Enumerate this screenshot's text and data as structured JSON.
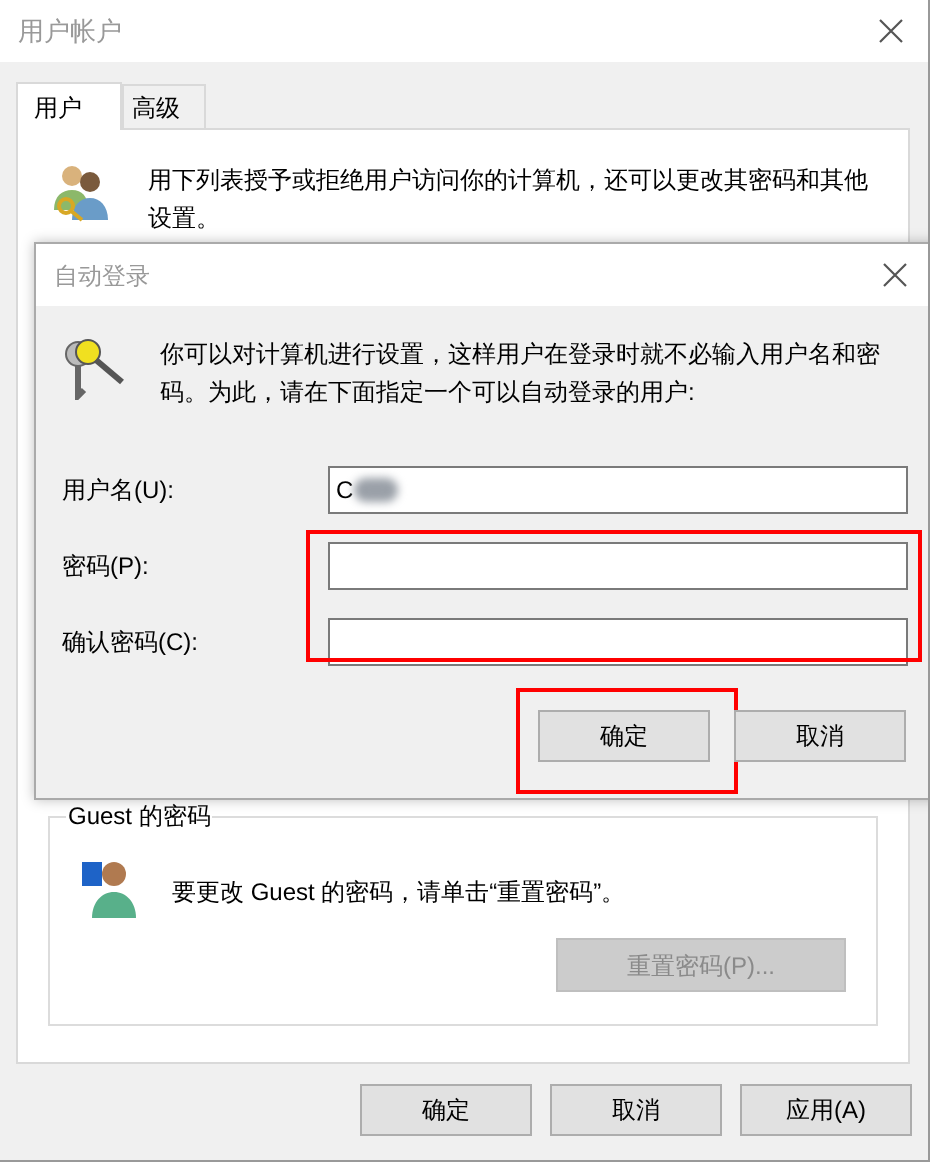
{
  "window": {
    "title": "用户帐户"
  },
  "tabs": [
    {
      "label": "用户",
      "selected": true
    },
    {
      "label": "高级",
      "selected": false
    }
  ],
  "description": "用下列表授予或拒绝用户访问你的计算机，还可以更改其密码和其他设置。",
  "guest_group": {
    "title": "Guest 的密码",
    "text": "要更改 Guest 的密码，请单击“重置密码”。",
    "button": {
      "label": "重置密码(P)...",
      "disabled": true
    }
  },
  "buttons": [
    {
      "label": "确定"
    },
    {
      "label": "取消"
    },
    {
      "label": "应用(A)"
    }
  ],
  "dialog": {
    "title": "自动登录",
    "text": "你可以对计算机进行设置，这样用户在登录时就不必输入用户名和密码。为此，请在下面指定一个可以自动登录的用户:",
    "fields": [
      {
        "label": "用户名(U):",
        "value": "C",
        "blurred": true,
        "highlighted": false
      },
      {
        "label": "密码(P):",
        "blurred": false,
        "highlighted": true
      },
      {
        "label": "确认密码(C):",
        "blurred": false,
        "highlighted": true
      }
    ],
    "buttons": [
      {
        "label": "确定",
        "highlighted": true
      },
      {
        "label": "取消",
        "highlighted": false
      }
    ]
  }
}
